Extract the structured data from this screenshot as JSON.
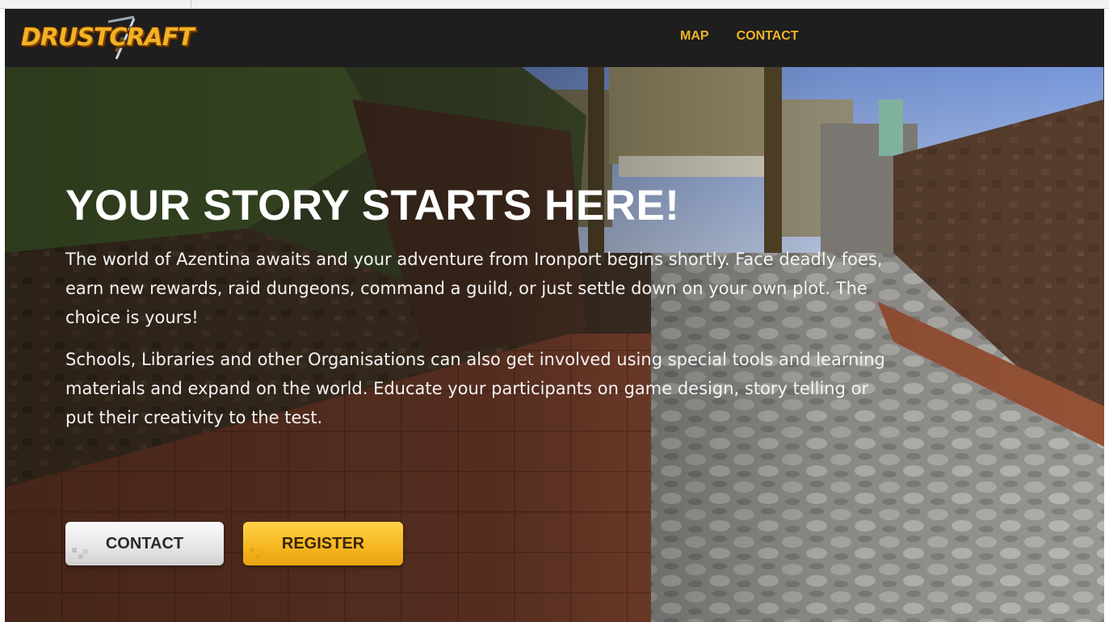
{
  "brand": {
    "logo_text": "DRUSTCRAFT"
  },
  "nav": {
    "items": [
      {
        "label": "MAP"
      },
      {
        "label": "CONTACT"
      }
    ]
  },
  "hero": {
    "title": "YOUR STORY STARTS HERE!",
    "paragraphs": [
      "The world of Azentina awaits and your adventure from Ironport begins shortly. Face deadly foes, earn new rewards, raid dungeons, command a guild, or just settle down on your own plot. The choice is yours!",
      "Schools, Libraries and other Organisations can also get involved using special tools and learning materials and expand on the world. Educate your participants on game design, story telling or put their creativity to the test."
    ],
    "buttons": {
      "contact_label": "CONTACT",
      "register_label": "REGISTER"
    }
  },
  "colors": {
    "nav_background": "#1e1e1e",
    "accent_gold": "#f0b528",
    "register_button": "#f7b821",
    "contact_button": "#e6e6e6"
  }
}
